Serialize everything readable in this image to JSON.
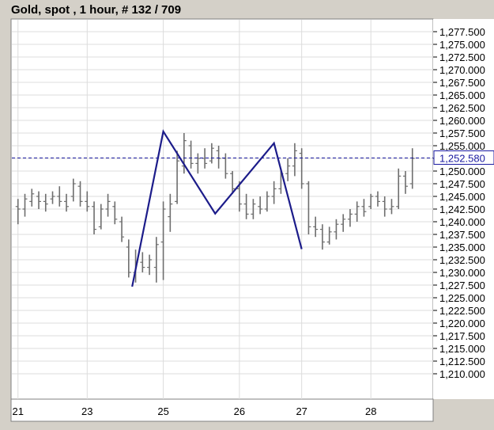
{
  "chart_title": "Gold, spot , 1 hour, # 132 / 709",
  "colors": {
    "background": "#d4d0c8",
    "plot_bg": "#ffffff",
    "grid": "#dcdcdc",
    "bars": "#6e6e6e",
    "pattern": "#1c1c8a",
    "current_price": "#1a1aa0"
  },
  "current_price_label": "1,252.580",
  "chart_data": {
    "type": "ohlc",
    "title": "Gold, spot , 1 hour, # 132 / 709",
    "x_ticks": [
      {
        "label": "21",
        "x": 0
      },
      {
        "label": "23",
        "x": 10
      },
      {
        "label": "25",
        "x": 21
      },
      {
        "label": "26",
        "x": 32
      },
      {
        "label": "27",
        "x": 41
      },
      {
        "label": "28",
        "x": 51
      }
    ],
    "xlim": [
      -1,
      60
    ],
    "ylim": [
      1205.0,
      1280.0
    ],
    "y_ticks": [
      "1,277.500",
      "1,275.000",
      "1,272.500",
      "1,270.000",
      "1,267.500",
      "1,265.000",
      "1,262.500",
      "1,260.000",
      "1,257.500",
      "1,255.000",
      "1,252.500",
      "1,250.000",
      "1,247.500",
      "1,245.000",
      "1,242.500",
      "1,240.000",
      "1,237.500",
      "1,235.000",
      "1,232.500",
      "1,230.000",
      "1,227.500",
      "1,225.000",
      "1,222.500",
      "1,220.000",
      "1,217.500",
      "1,215.000",
      "1,212.500",
      "1,210.000"
    ],
    "y_tick_values": [
      1277.5,
      1275,
      1272.5,
      1270,
      1267.5,
      1265,
      1262.5,
      1260,
      1257.5,
      1255,
      1252.5,
      1250,
      1247.5,
      1245,
      1242.5,
      1240,
      1237.5,
      1235,
      1232.5,
      1230,
      1227.5,
      1225,
      1222.5,
      1220,
      1217.5,
      1215,
      1212.5,
      1210
    ],
    "current_price": 1252.58,
    "bars": [
      {
        "h": 1244.5,
        "l": 1239.5,
        "o": 1243.0,
        "c": 1242.5
      },
      {
        "h": 1245.5,
        "l": 1241.0,
        "o": 1242.5,
        "c": 1244.5
      },
      {
        "h": 1246.5,
        "l": 1243.0,
        "o": 1244.0,
        "c": 1245.5
      },
      {
        "h": 1246.0,
        "l": 1242.5,
        "o": 1245.0,
        "c": 1244.0
      },
      {
        "h": 1245.5,
        "l": 1242.0,
        "o": 1244.0,
        "c": 1243.5
      },
      {
        "h": 1246.0,
        "l": 1243.5,
        "o": 1244.5,
        "c": 1245.0
      },
      {
        "h": 1247.0,
        "l": 1243.0,
        "o": 1245.0,
        "c": 1244.0
      },
      {
        "h": 1245.5,
        "l": 1242.0,
        "o": 1244.0,
        "c": 1243.0
      },
      {
        "h": 1248.5,
        "l": 1244.0,
        "o": 1245.0,
        "c": 1247.5
      },
      {
        "h": 1248.0,
        "l": 1243.0,
        "o": 1247.0,
        "c": 1244.0
      },
      {
        "h": 1246.0,
        "l": 1242.0,
        "o": 1244.0,
        "c": 1243.0
      },
      {
        "h": 1244.0,
        "l": 1237.5,
        "o": 1243.0,
        "c": 1238.5
      },
      {
        "h": 1243.5,
        "l": 1238.5,
        "o": 1239.0,
        "c": 1242.5
      },
      {
        "h": 1245.5,
        "l": 1241.0,
        "o": 1242.5,
        "c": 1244.0
      },
      {
        "h": 1244.0,
        "l": 1239.5,
        "o": 1243.0,
        "c": 1240.5
      },
      {
        "h": 1241.0,
        "l": 1236.0,
        "o": 1240.0,
        "c": 1237.0
      },
      {
        "h": 1236.5,
        "l": 1229.0,
        "o": 1235.0,
        "c": 1230.0
      },
      {
        "h": 1234.5,
        "l": 1228.0,
        "o": 1230.0,
        "c": 1232.0
      },
      {
        "h": 1234.0,
        "l": 1230.0,
        "o": 1232.0,
        "c": 1231.0
      },
      {
        "h": 1233.5,
        "l": 1229.5,
        "o": 1231.0,
        "c": 1232.5
      },
      {
        "h": 1237.0,
        "l": 1228.0,
        "o": 1231.0,
        "c": 1235.5
      },
      {
        "h": 1244.0,
        "l": 1228.5,
        "o": 1236.0,
        "c": 1242.5
      },
      {
        "h": 1245.5,
        "l": 1238.0,
        "o": 1241.0,
        "c": 1243.5
      },
      {
        "h": 1254.0,
        "l": 1243.5,
        "o": 1244.0,
        "c": 1252.0
      },
      {
        "h": 1257.5,
        "l": 1249.5,
        "o": 1251.0,
        "c": 1256.0
      },
      {
        "h": 1256.0,
        "l": 1250.5,
        "o": 1255.0,
        "c": 1251.5
      },
      {
        "h": 1253.5,
        "l": 1249.5,
        "o": 1251.5,
        "c": 1252.5
      },
      {
        "h": 1254.5,
        "l": 1250.5,
        "o": 1252.5,
        "c": 1251.5
      },
      {
        "h": 1255.5,
        "l": 1251.5,
        "o": 1252.0,
        "c": 1254.5
      },
      {
        "h": 1255.0,
        "l": 1250.5,
        "o": 1254.0,
        "c": 1252.5
      },
      {
        "h": 1253.5,
        "l": 1248.5,
        "o": 1252.5,
        "c": 1249.5
      },
      {
        "h": 1250.0,
        "l": 1245.5,
        "o": 1249.5,
        "c": 1246.5
      },
      {
        "h": 1248.0,
        "l": 1242.0,
        "o": 1246.5,
        "c": 1243.5
      },
      {
        "h": 1245.5,
        "l": 1240.5,
        "o": 1243.5,
        "c": 1241.5
      },
      {
        "h": 1244.5,
        "l": 1240.5,
        "o": 1241.5,
        "c": 1243.5
      },
      {
        "h": 1245.0,
        "l": 1241.5,
        "o": 1243.0,
        "c": 1242.5
      },
      {
        "h": 1246.0,
        "l": 1242.0,
        "o": 1242.5,
        "c": 1245.0
      },
      {
        "h": 1248.0,
        "l": 1243.5,
        "o": 1245.0,
        "c": 1246.5
      },
      {
        "h": 1250.5,
        "l": 1245.5,
        "o": 1246.5,
        "c": 1249.5
      },
      {
        "h": 1252.5,
        "l": 1248.0,
        "o": 1249.5,
        "c": 1251.0
      },
      {
        "h": 1255.5,
        "l": 1249.0,
        "o": 1251.0,
        "c": 1254.0
      },
      {
        "h": 1254.5,
        "l": 1246.5,
        "o": 1253.5,
        "c": 1247.5
      },
      {
        "h": 1248.0,
        "l": 1237.5,
        "o": 1247.5,
        "c": 1239.0
      },
      {
        "h": 1241.0,
        "l": 1237.0,
        "o": 1239.0,
        "c": 1238.5
      },
      {
        "h": 1239.5,
        "l": 1234.5,
        "o": 1238.5,
        "c": 1236.0
      },
      {
        "h": 1239.0,
        "l": 1235.5,
        "o": 1236.0,
        "c": 1238.0
      },
      {
        "h": 1240.5,
        "l": 1236.5,
        "o": 1238.0,
        "c": 1239.5
      },
      {
        "h": 1241.5,
        "l": 1238.0,
        "o": 1239.5,
        "c": 1240.5
      },
      {
        "h": 1242.5,
        "l": 1239.0,
        "o": 1240.5,
        "c": 1241.5
      },
      {
        "h": 1244.0,
        "l": 1240.0,
        "o": 1241.5,
        "c": 1243.0
      },
      {
        "h": 1244.5,
        "l": 1241.0,
        "o": 1243.0,
        "c": 1242.0
      },
      {
        "h": 1245.5,
        "l": 1242.5,
        "o": 1243.0,
        "c": 1245.0
      },
      {
        "h": 1246.0,
        "l": 1243.0,
        "o": 1245.0,
        "c": 1244.0
      },
      {
        "h": 1245.0,
        "l": 1241.0,
        "o": 1244.0,
        "c": 1242.5
      },
      {
        "h": 1244.5,
        "l": 1241.5,
        "o": 1242.5,
        "c": 1243.0
      },
      {
        "h": 1250.5,
        "l": 1242.5,
        "o": 1243.0,
        "c": 1249.0
      },
      {
        "h": 1250.0,
        "l": 1245.5,
        "o": 1249.0,
        "c": 1247.0
      },
      {
        "h": 1254.5,
        "l": 1246.5,
        "o": 1247.5,
        "c": 1252.5
      }
    ],
    "pattern_line": [
      {
        "x": 16.5,
        "y": 1227.2
      },
      {
        "x": 21.0,
        "y": 1257.8
      },
      {
        "x": 28.5,
        "y": 1241.6
      },
      {
        "x": 37.0,
        "y": 1255.5
      },
      {
        "x": 41.0,
        "y": 1234.6
      }
    ]
  }
}
